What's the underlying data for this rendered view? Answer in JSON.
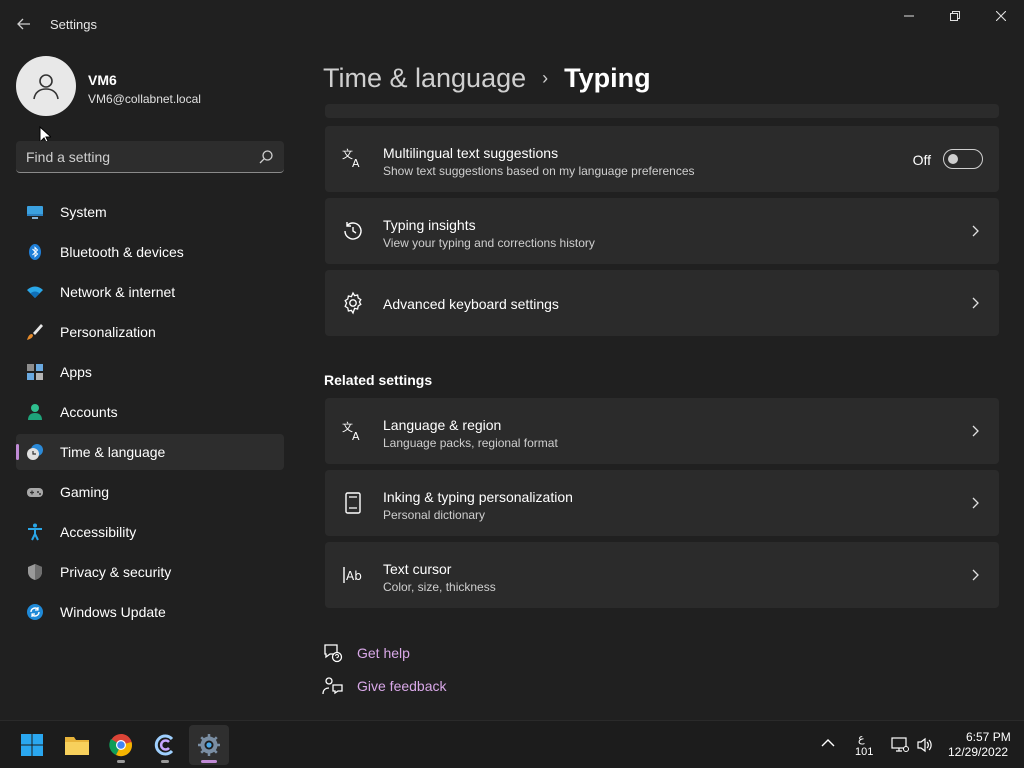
{
  "window": {
    "title": "Settings",
    "back_icon": "back-arrow-icon",
    "controls": [
      "minimize",
      "maximize",
      "close"
    ]
  },
  "profile": {
    "name": "VM6",
    "email": "VM6@collabnet.local"
  },
  "search": {
    "placeholder": "Find a setting",
    "value": ""
  },
  "sidebar": {
    "items": [
      {
        "label": "System",
        "icon": "monitor-icon",
        "active": false
      },
      {
        "label": "Bluetooth & devices",
        "icon": "bluetooth-icon",
        "active": false
      },
      {
        "label": "Network & internet",
        "icon": "wifi-icon",
        "active": false
      },
      {
        "label": "Personalization",
        "icon": "paintbrush-icon",
        "active": false
      },
      {
        "label": "Apps",
        "icon": "apps-icon",
        "active": false
      },
      {
        "label": "Accounts",
        "icon": "person-icon",
        "active": false
      },
      {
        "label": "Time & language",
        "icon": "clock-globe-icon",
        "active": true
      },
      {
        "label": "Gaming",
        "icon": "gamepad-icon",
        "active": false
      },
      {
        "label": "Accessibility",
        "icon": "accessibility-icon",
        "active": false
      },
      {
        "label": "Privacy & security",
        "icon": "shield-icon",
        "active": false
      },
      {
        "label": "Windows Update",
        "icon": "update-icon",
        "active": false
      }
    ]
  },
  "breadcrumb": {
    "parent": "Time & language",
    "separator": "›",
    "current": "Typing"
  },
  "settings": {
    "multilingual": {
      "title": "Multilingual text suggestions",
      "subtitle": "Show text suggestions based on my language preferences",
      "state_label": "Off",
      "enabled": false
    },
    "insights": {
      "title": "Typing insights",
      "subtitle": "View your typing and corrections history"
    },
    "advanced": {
      "title": "Advanced keyboard settings"
    }
  },
  "related": {
    "heading": "Related settings",
    "items": [
      {
        "title": "Language & region",
        "subtitle": "Language packs, regional format"
      },
      {
        "title": "Inking & typing personalization",
        "subtitle": "Personal dictionary"
      },
      {
        "title": "Text cursor",
        "subtitle": "Color, size, thickness"
      }
    ]
  },
  "help": {
    "get_help": "Get help",
    "give_feedback": "Give feedback"
  },
  "taskbar": {
    "apps": [
      "windows-start",
      "file-explorer",
      "chrome",
      "cortana-c",
      "settings"
    ],
    "input_indicator_top": "ع",
    "input_indicator_bottom": "101",
    "time": "6:57 PM",
    "date": "12/29/2022"
  },
  "colors": {
    "background": "#202020",
    "card": "#2b2b2b",
    "accent": "#c08bd6",
    "link": "#d9a8e8"
  }
}
